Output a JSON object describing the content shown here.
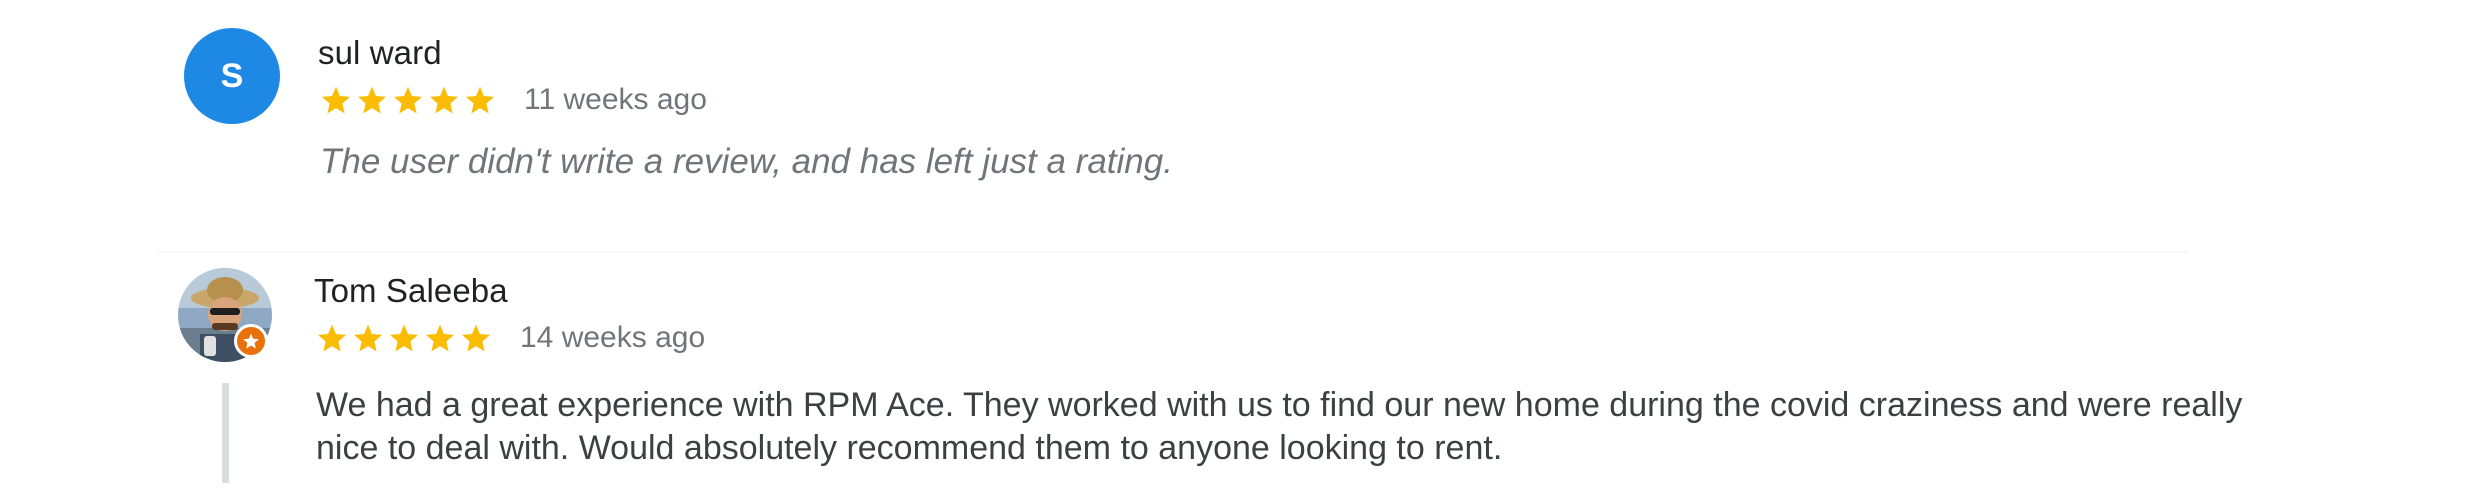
{
  "reviews": [
    {
      "author": "sul ward",
      "avatar_initial": "S",
      "avatar_color": "#1e88e5",
      "rating": 5,
      "rating_max": 5,
      "time_ago": "11 weeks ago",
      "text": "The user didn't write a review, and has left just a rating."
    },
    {
      "author": "Tom Saleeba",
      "avatar_type": "photo",
      "badge_icon": "local-guide-star-icon",
      "badge_color": "#e8710a",
      "rating": 5,
      "rating_max": 5,
      "time_ago": "14 weeks ago",
      "text": "We had a great experience with RPM Ace. They worked with us to find our new home during the covid craziness and were really nice to deal with. Would absolutely recommend them to anyone looking to rent."
    }
  ],
  "colors": {
    "star": "#fbbc04",
    "name": "#202124",
    "muted": "#70757a",
    "body_text": "#3c4043"
  }
}
